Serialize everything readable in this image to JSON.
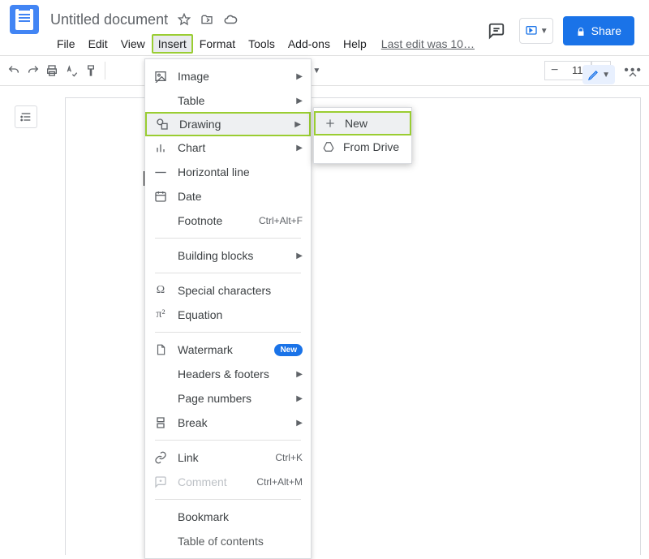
{
  "header": {
    "doc_title": "Untitled document",
    "last_edit": "Last edit was 10…",
    "share_label": "Share"
  },
  "menubar": [
    "File",
    "Edit",
    "View",
    "Insert",
    "Format",
    "Tools",
    "Add-ons",
    "Help"
  ],
  "toolbar": {
    "font_size": "11"
  },
  "insert_menu": {
    "image": "Image",
    "table": "Table",
    "drawing": "Drawing",
    "chart": "Chart",
    "horizontal_line": "Horizontal line",
    "date": "Date",
    "footnote": "Footnote",
    "footnote_shortcut": "Ctrl+Alt+F",
    "building_blocks": "Building blocks",
    "special_characters": "Special characters",
    "equation": "Equation",
    "watermark": "Watermark",
    "watermark_badge": "New",
    "headers_footers": "Headers & footers",
    "page_numbers": "Page numbers",
    "break": "Break",
    "link": "Link",
    "link_shortcut": "Ctrl+K",
    "comment": "Comment",
    "comment_shortcut": "Ctrl+Alt+M",
    "bookmark": "Bookmark",
    "toc": "Table of contents"
  },
  "drawing_submenu": {
    "new": "New",
    "from_drive": "From Drive"
  }
}
